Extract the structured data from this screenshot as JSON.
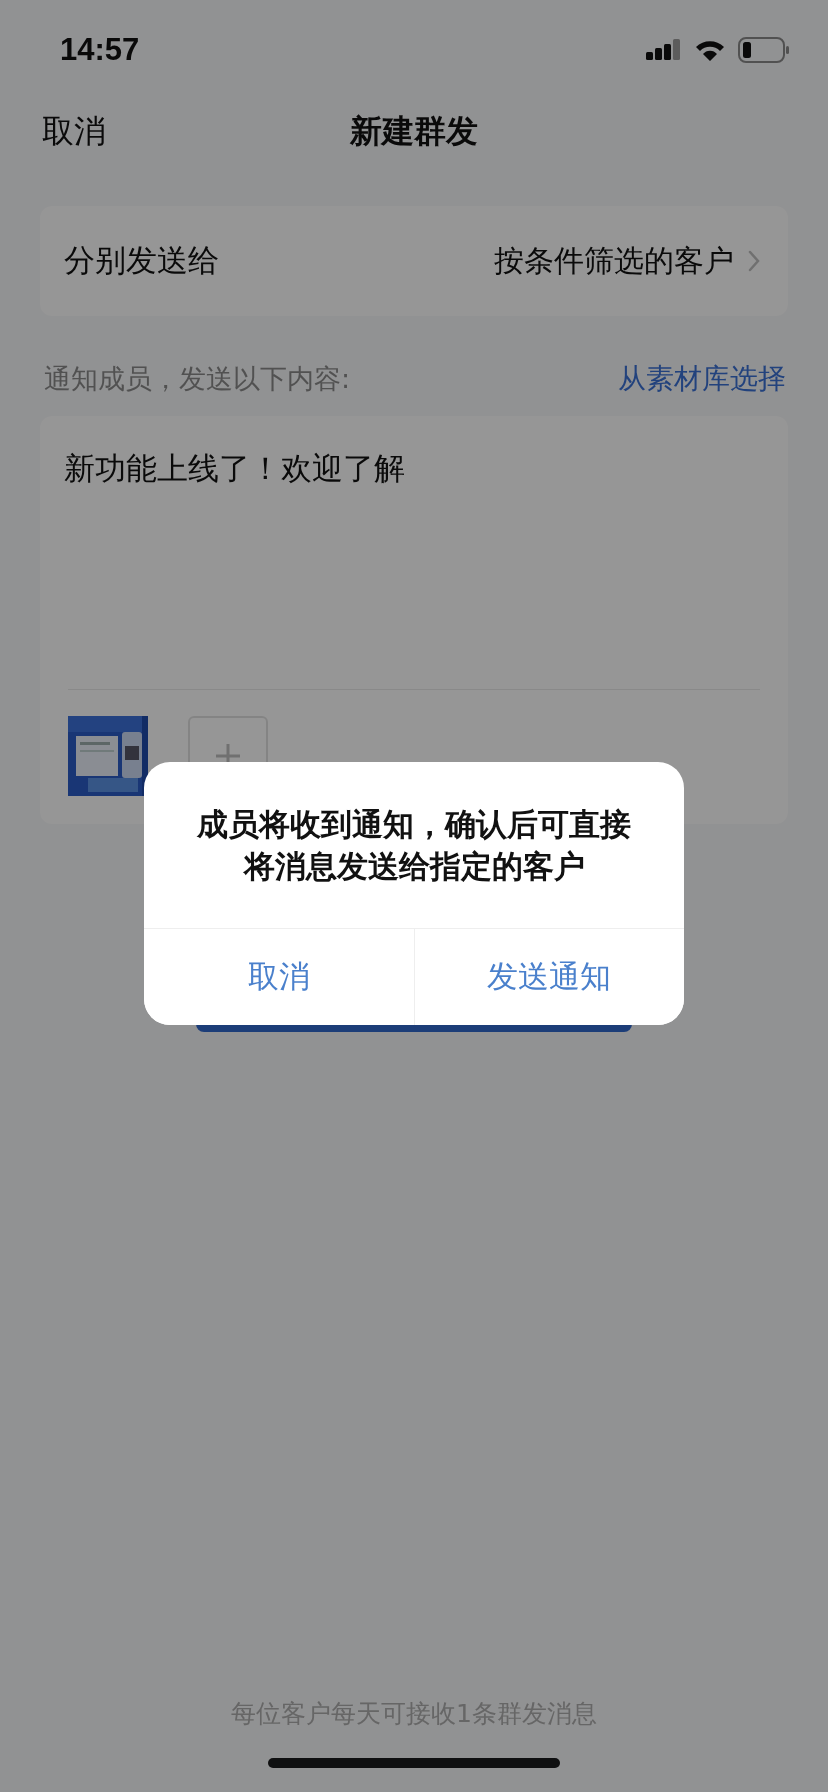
{
  "status_bar": {
    "time": "14:57"
  },
  "nav": {
    "cancel": "取消",
    "title": "新建群发"
  },
  "recipients": {
    "label": "分别发送给",
    "value": "按条件筛选的客户"
  },
  "content": {
    "label": "通知成员，发送以下内容:",
    "library_link": "从素材库选择",
    "message": "新功能上线了！欢迎了解"
  },
  "footer_note": "每位客户每天可接收1条群发消息",
  "dialog": {
    "message": "成员将收到通知，确认后可直接将消息发送给指定的客户",
    "buttons": [
      {
        "label": "取消",
        "kind": "cancel"
      },
      {
        "label": "发送通知",
        "kind": "confirm"
      }
    ]
  }
}
